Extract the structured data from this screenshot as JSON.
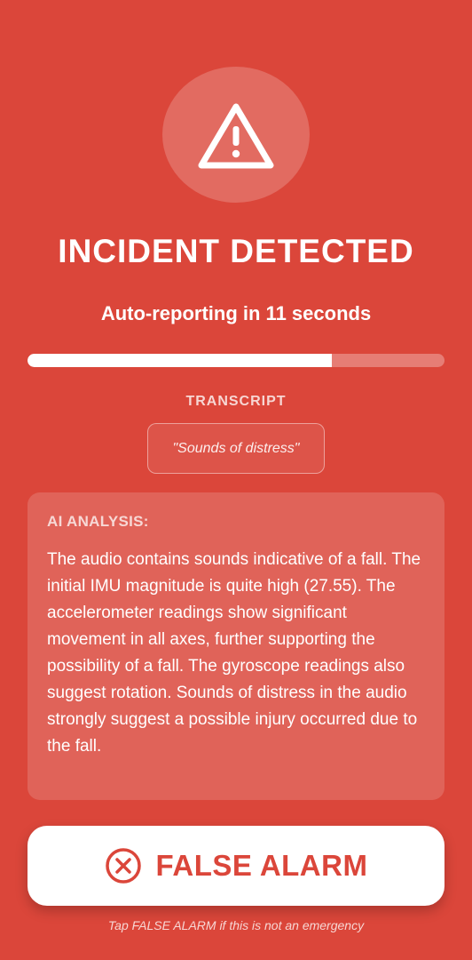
{
  "alert": {
    "icon": "warning-triangle-icon",
    "title": "INCIDENT DETECTED",
    "countdown_text": "Auto-reporting in 11 seconds",
    "progress_fraction": 0.73
  },
  "transcript": {
    "label": "TRANSCRIPT",
    "text": "\"Sounds of distress\""
  },
  "analysis": {
    "label": "AI ANALYSIS:",
    "text": "The audio contains sounds indicative of a fall. The initial IMU magnitude is quite high (27.55). The accelerometer readings show significant movement in all axes, further supporting the possibility of a fall. The gyroscope readings also suggest rotation. Sounds of distress in the audio strongly suggest a possible injury occurred due to the fall."
  },
  "actions": {
    "false_alarm_label": "FALSE ALARM",
    "false_alarm_icon": "close-circle-icon",
    "hint": "Tap FALSE ALARM if this is not an emergency"
  },
  "colors": {
    "background": "#DB463A",
    "accent_text": "#DB463A",
    "foreground": "#FFFFFF"
  }
}
